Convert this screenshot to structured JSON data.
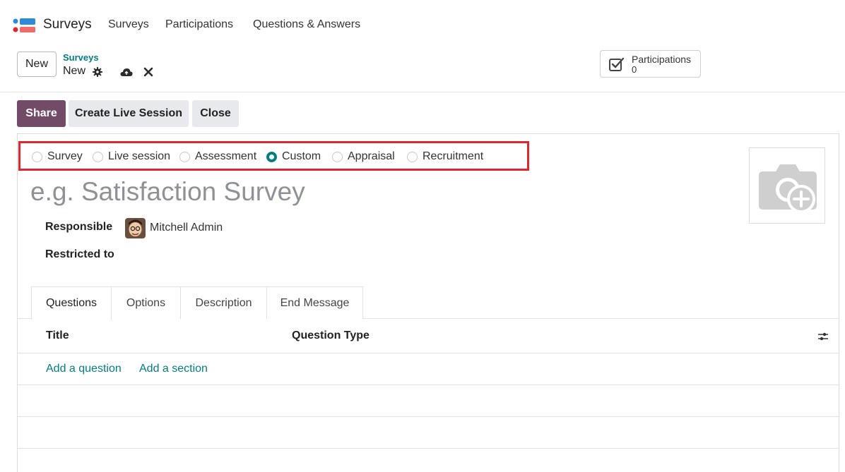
{
  "navbar": {
    "app_name": "Surveys",
    "menus": [
      "Surveys",
      "Participations",
      "Questions & Answers"
    ]
  },
  "control_panel": {
    "new_label": "New",
    "breadcrumb_parent": "Surveys",
    "breadcrumb_current": "New",
    "stat_button": {
      "label": "Participations",
      "value": "0"
    }
  },
  "actions": {
    "share": "Share",
    "create_live_session": "Create Live Session",
    "close": "Close"
  },
  "survey_types": [
    {
      "label": "Survey",
      "selected": false
    },
    {
      "label": "Live session",
      "selected": false
    },
    {
      "label": "Assessment",
      "selected": false
    },
    {
      "label": "Custom",
      "selected": true
    },
    {
      "label": "Appraisal",
      "selected": false
    },
    {
      "label": "Recruitment",
      "selected": false
    }
  ],
  "form": {
    "title_placeholder": "e.g. Satisfaction Survey",
    "title_value": "",
    "responsible_label": "Responsible",
    "responsible_value": "Mitchell Admin",
    "restricted_label": "Restricted to",
    "restricted_value": ""
  },
  "tabs": [
    {
      "label": "Questions",
      "active": true
    },
    {
      "label": "Options",
      "active": false
    },
    {
      "label": "Description",
      "active": false
    },
    {
      "label": "End Message",
      "active": false
    }
  ],
  "questions_list": {
    "columns": [
      "Title",
      "Question Type"
    ],
    "add_question": "Add a question",
    "add_section": "Add a section"
  },
  "colors": {
    "primary": "#714b67",
    "accent": "#017e84",
    "highlight_border": "#e0262e"
  }
}
